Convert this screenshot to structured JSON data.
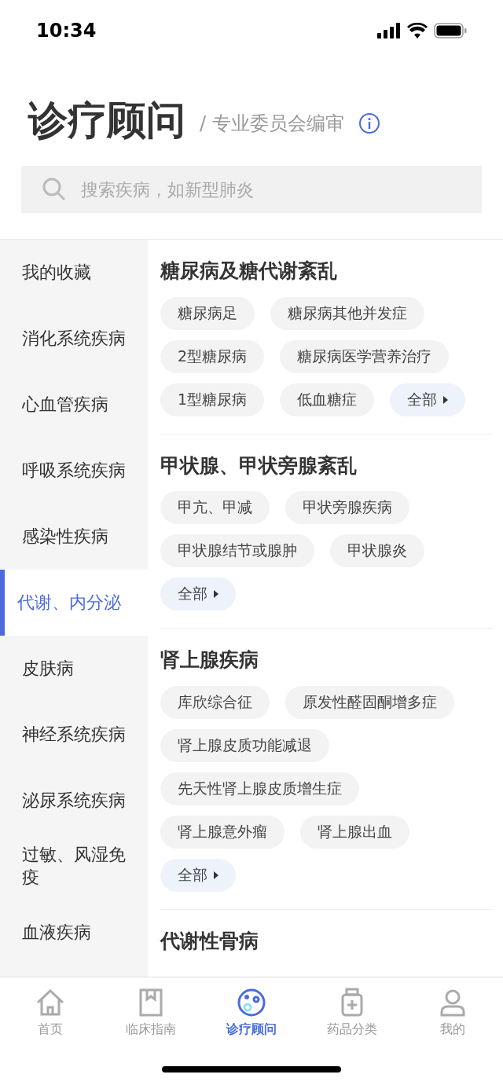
{
  "status_bar": {
    "time": "10:34"
  },
  "header": {
    "title": "诊疗顾问",
    "subtitle": "/ 专业委员会编审"
  },
  "search": {
    "placeholder": "搜索疾病，如新型肺炎"
  },
  "sidebar": {
    "items": [
      {
        "label": "我的收藏",
        "selected": false
      },
      {
        "label": "消化系统疾病",
        "selected": false
      },
      {
        "label": "心血管疾病",
        "selected": false
      },
      {
        "label": "呼吸系统疾病",
        "selected": false
      },
      {
        "label": "感染性疾病",
        "selected": false
      },
      {
        "label": "代谢、内分泌",
        "selected": true
      },
      {
        "label": "皮肤病",
        "selected": false
      },
      {
        "label": "神经系统疾病",
        "selected": false
      },
      {
        "label": "泌尿系统疾病",
        "selected": false
      },
      {
        "label": "过敏、风湿免疫",
        "selected": false
      },
      {
        "label": "血液疾病",
        "selected": false
      }
    ]
  },
  "sections": [
    {
      "title": "糖尿病及糖代谢紊乱",
      "tags": [
        "糖尿病足",
        "糖尿病其他并发症",
        "2型糖尿病",
        "糖尿病医学营养治疗",
        "1型糖尿病",
        "低血糖症"
      ],
      "more": "全部"
    },
    {
      "title": "甲状腺、甲状旁腺紊乱",
      "tags": [
        "甲亢、甲减",
        "甲状旁腺疾病",
        "甲状腺结节或腺肿",
        "甲状腺炎"
      ],
      "more": "全部"
    },
    {
      "title": "肾上腺疾病",
      "tags": [
        "库欣综合征",
        "原发性醛固酮增多症",
        "肾上腺皮质功能减退",
        "先天性肾上腺皮质增生症",
        "肾上腺意外瘤",
        "肾上腺出血"
      ],
      "more": "全部"
    },
    {
      "title": "代谢性骨病"
    }
  ],
  "tab_bar": [
    {
      "label": "首页",
      "kind": "home",
      "selected": false
    },
    {
      "label": "临床指南",
      "kind": "guide",
      "selected": false
    },
    {
      "label": "诊疗顾问",
      "kind": "advisor",
      "selected": true
    },
    {
      "label": "药品分类",
      "kind": "drugs",
      "selected": false
    },
    {
      "label": "我的",
      "kind": "profile",
      "selected": false
    }
  ]
}
